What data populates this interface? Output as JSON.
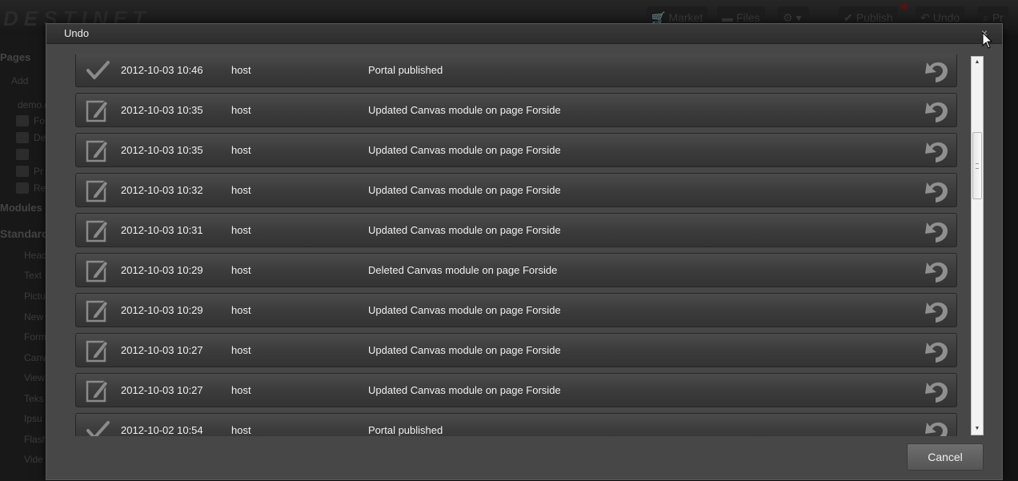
{
  "background_app": {
    "logo": "DESTINET",
    "toolbar": [
      {
        "label": "Market",
        "icon": "cart-icon"
      },
      {
        "label": "Files",
        "icon": "folder-icon"
      },
      {
        "label": "",
        "icon": "gear-icon"
      },
      {
        "label": "Publish",
        "icon": "check-icon"
      },
      {
        "label": "Undo",
        "icon": "undo-icon"
      },
      {
        "label": "Pr",
        "icon": "search-icon"
      }
    ],
    "sidebar": {
      "pages_heading": "Pages",
      "add_label": "Add",
      "tree": [
        "demo.c",
        "Fo",
        "De",
        "",
        "Pr",
        "Re"
      ],
      "modules_heading": "Modules",
      "standard_heading": "Standard",
      "modules": [
        "Head",
        "Text",
        "Pictu",
        "New",
        "Form",
        "Canv",
        "View",
        "Teks",
        "Ipsu",
        "Flash",
        "Vide"
      ]
    }
  },
  "modal": {
    "title": "Undo",
    "close_label": "×",
    "cancel_label": "Cancel",
    "entries": [
      {
        "type": "publish",
        "icon": "checkmark-icon",
        "date": "2012-10-03 10:46",
        "user": "host",
        "description": "Portal published"
      },
      {
        "type": "edit",
        "icon": "pencil-icon",
        "date": "2012-10-03 10:35",
        "user": "host",
        "description": "Updated Canvas module on page Forside"
      },
      {
        "type": "edit",
        "icon": "pencil-icon",
        "date": "2012-10-03 10:35",
        "user": "host",
        "description": "Updated Canvas module on page Forside"
      },
      {
        "type": "edit",
        "icon": "pencil-icon",
        "date": "2012-10-03 10:32",
        "user": "host",
        "description": "Updated Canvas module on page Forside"
      },
      {
        "type": "edit",
        "icon": "pencil-icon",
        "date": "2012-10-03 10:31",
        "user": "host",
        "description": "Updated Canvas module on page Forside"
      },
      {
        "type": "edit",
        "icon": "pencil-icon",
        "date": "2012-10-03 10:29",
        "user": "host",
        "description": "Deleted Canvas module on page Forside"
      },
      {
        "type": "edit",
        "icon": "pencil-icon",
        "date": "2012-10-03 10:29",
        "user": "host",
        "description": "Updated Canvas module on page Forside"
      },
      {
        "type": "edit",
        "icon": "pencil-icon",
        "date": "2012-10-03 10:27",
        "user": "host",
        "description": "Updated Canvas module on page Forside"
      },
      {
        "type": "edit",
        "icon": "pencil-icon",
        "date": "2012-10-03 10:27",
        "user": "host",
        "description": "Updated Canvas module on page Forside"
      },
      {
        "type": "publish",
        "icon": "checkmark-icon",
        "date": "2012-10-02 10:54",
        "user": "host",
        "description": "Portal published"
      }
    ]
  },
  "colors": {
    "modal_bg": "#474747",
    "row_bg": "#3c3c3c",
    "text": "#f0f0f0",
    "icon_gray": "#8a8a8a"
  }
}
